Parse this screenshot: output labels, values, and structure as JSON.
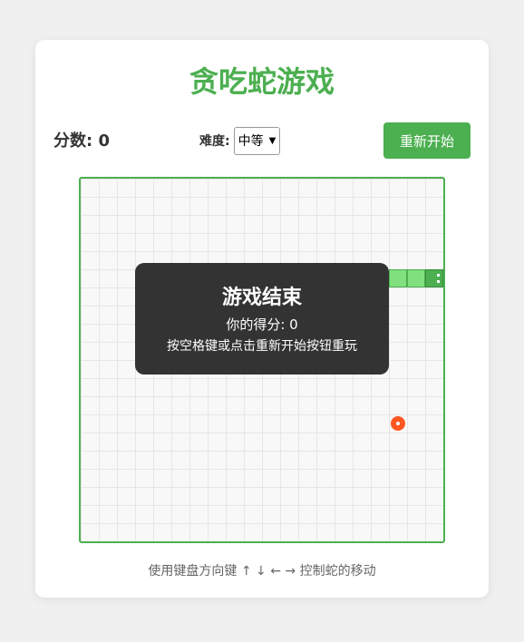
{
  "game": {
    "title": "贪吃蛇游戏",
    "score_label": "分数: 0",
    "difficulty_label": "难度:",
    "difficulty_selected": "中等",
    "restart_label": "重新开始",
    "instructions": "使用键盘方向键 ↑ ↓ ← → 控制蛇的移动"
  },
  "game_over": {
    "title": "游戏结束",
    "score_text": "你的得分: 0",
    "hint": "按空格键或点击重新开始按钮重玩"
  },
  "board": {
    "grid_cells": 20,
    "snake": [
      {
        "col": 19,
        "row": 5,
        "head": true
      },
      {
        "col": 18,
        "row": 5,
        "head": false
      },
      {
        "col": 17,
        "row": 5,
        "head": false
      }
    ],
    "food": {
      "col": 17,
      "row": 13
    }
  },
  "colors": {
    "accent": "#4caf50",
    "snake_body": "#81e07e",
    "snake_head": "#4caf50",
    "food": "#ff5722",
    "overlay": "#282828"
  },
  "icons": {
    "difficulty_dropdown": "chevron-down-icon"
  }
}
